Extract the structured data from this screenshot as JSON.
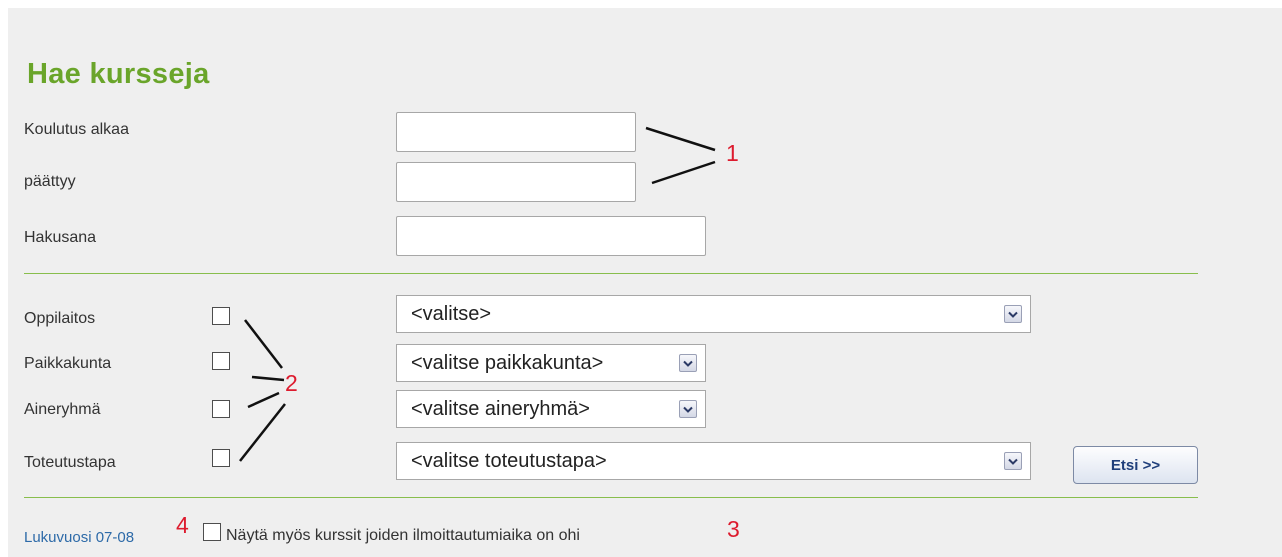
{
  "page": {
    "title": "Hae kursseja"
  },
  "dates": {
    "start_label": "Koulutus alkaa",
    "start_value": "",
    "end_label": "päättyy",
    "end_value": ""
  },
  "keyword": {
    "label": "Hakusana",
    "value": ""
  },
  "filters": {
    "oppilaitos": {
      "label": "Oppilaitos",
      "checked": false,
      "selected": "<valitse>"
    },
    "paikkakunta": {
      "label": "Paikkakunta",
      "checked": false,
      "selected": "<valitse paikkakunta>"
    },
    "aineryhma": {
      "label": "Aineryhmä",
      "checked": false,
      "selected": "<valitse aineryhmä>"
    },
    "toteutustapa": {
      "label": "Toteutustapa",
      "checked": false,
      "selected": "<valitse toteutustapa>"
    }
  },
  "search_button": {
    "label": "Etsi >>"
  },
  "footer": {
    "year_link": "Lukuvuosi 07-08",
    "show_expired_label": "Näytä myös kurssit joiden ilmoittautumiaika on ohi",
    "show_expired_checked": false
  },
  "annotations": {
    "a1": "1",
    "a2": "2",
    "a3": "3",
    "a4": "4"
  },
  "colors": {
    "title": "#6aa52a",
    "divider": "#88be4c",
    "annotation": "#dd1b2e",
    "link": "#2d6aa8",
    "button_text": "#1f3e7a"
  },
  "icons": {
    "dropdown": "chevron-down-icon"
  }
}
